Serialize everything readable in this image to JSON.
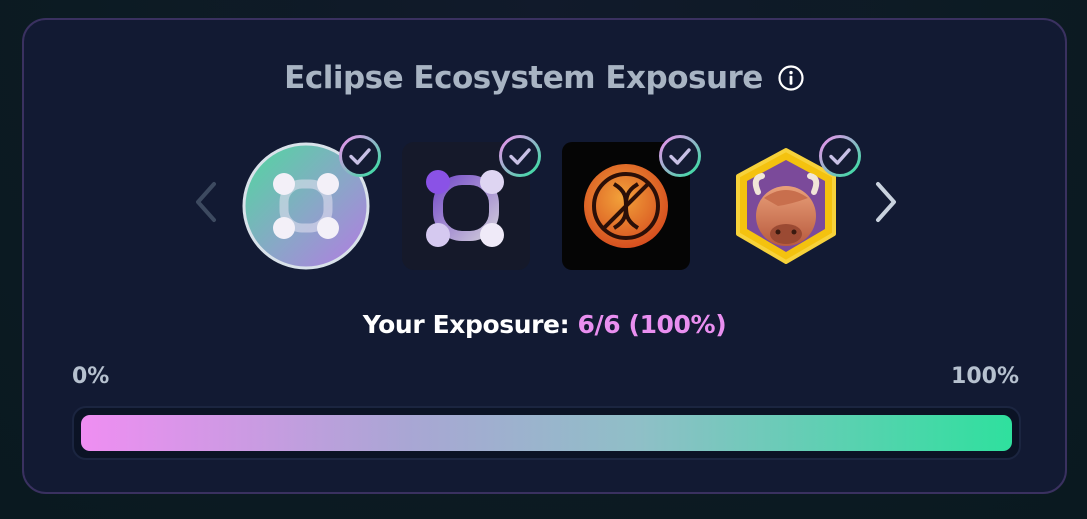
{
  "card": {
    "title": "Eclipse Ecosystem Exposure"
  },
  "carousel": {
    "prev_icon": "chevron-left-icon",
    "next_icon": "chevron-right-icon",
    "tokens": [
      {
        "logo": "circle-nodes-logo",
        "checked": true
      },
      {
        "logo": "rounded-square-nodes-logo",
        "checked": true
      },
      {
        "logo": "orange-dna-coin-logo",
        "checked": true
      },
      {
        "logo": "bison-hexagon-logo",
        "checked": true
      }
    ]
  },
  "exposure": {
    "label": "Your Exposure: ",
    "value": "6/6 (100%)",
    "fraction": 1.0
  },
  "scale": {
    "min": "0%",
    "max": "100%"
  },
  "colors": {
    "card_bg": "#121a33",
    "card_border": "#3a3160",
    "title": "#a8b4c3",
    "accent_pink": "#e98ff0",
    "accent_green": "#2fe09e"
  }
}
